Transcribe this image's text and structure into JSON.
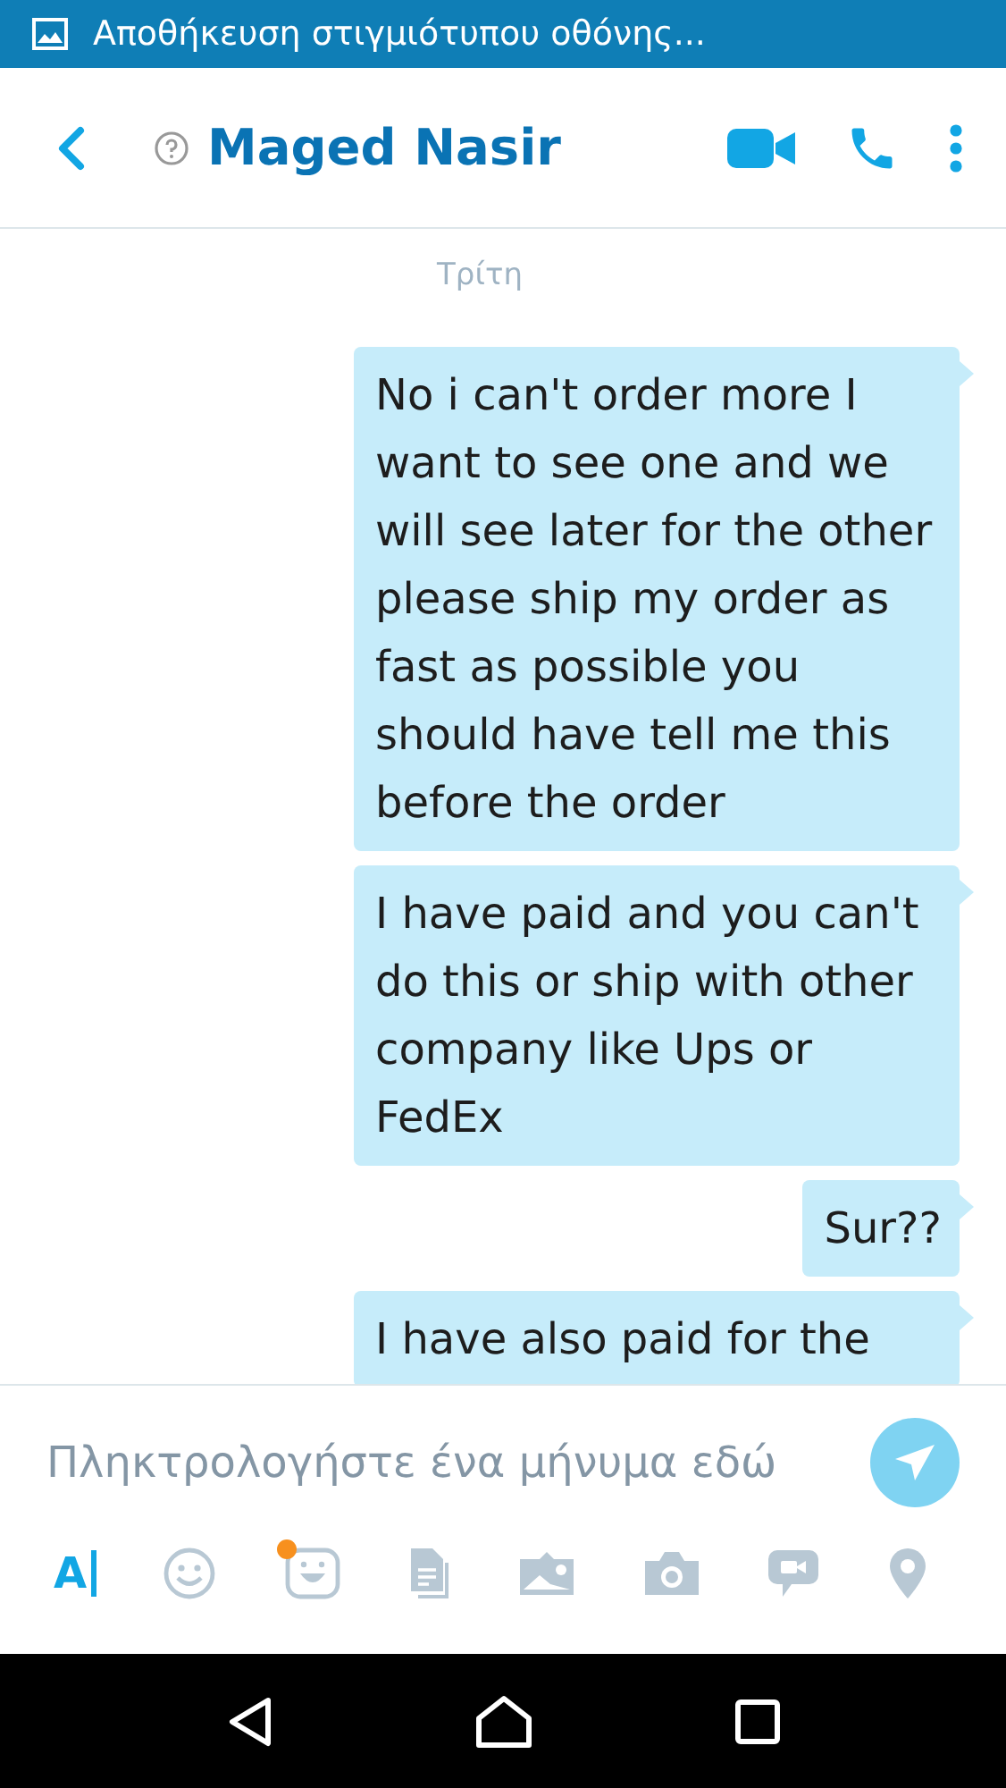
{
  "status_bar": {
    "notification": "Αποθήκευση στιγμιότυπου οθόνης..."
  },
  "header": {
    "contact_name": "Maged Nasir"
  },
  "day_separator": "Τρίτη",
  "messages": [
    {
      "text": "No i can't order more I want to see one and we will see later for the other please ship my order as fast as possible you should have tell me this before the order",
      "outgoing": true
    },
    {
      "text": "I have paid and you can't do this or ship with other company like Ups or FedEx",
      "outgoing": true
    },
    {
      "text": "Sur??",
      "outgoing": true
    },
    {
      "text": "I have also paid for the",
      "outgoing": true
    }
  ],
  "composer": {
    "placeholder": "Πληκτρολογήστε ένα μήνυμα εδώ"
  },
  "toolbar": {
    "format_text": "A",
    "sticker_badge": true
  }
}
